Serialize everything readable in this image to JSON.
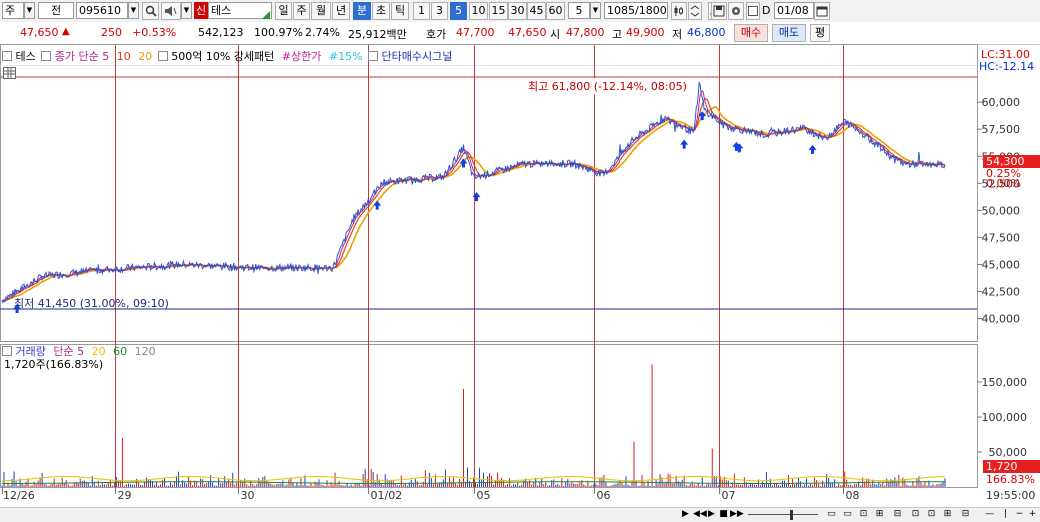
{
  "toolbar": {
    "market": "주",
    "period_type": "전",
    "code": "095610",
    "badge": "신",
    "name": "테스",
    "periods": [
      "일",
      "주",
      "월",
      "년",
      "분",
      "초",
      "틱"
    ],
    "selected_period": "분",
    "minutes": [
      "1",
      "3",
      "5",
      "10",
      "15",
      "30",
      "45",
      "60"
    ],
    "selected_minute": "5",
    "count_input": "5",
    "bars": "1085",
    "bars_total": "/1800",
    "d_label": "D",
    "date": "01/08"
  },
  "quote": {
    "price": "47,650",
    "arrow": "▲",
    "change": "250",
    "change_pct": "+0.53%",
    "volume": "542,123",
    "vol_ratio": "100.97%",
    "turnover": "2.74%",
    "amount": "25,912백만",
    "ask_label": "호가",
    "ask": "47,700",
    "bid": "47,650",
    "open_label": "시",
    "open": "47,800",
    "high_label": "고",
    "high": "49,900",
    "low_label": "저",
    "low": "46,800",
    "buy": "매수",
    "sell": "매도",
    "eval": "평"
  },
  "legend": {
    "name": "테스",
    "ma_label": "종가 단순",
    "ma5": "5",
    "ma10": "10",
    "ma20": "20",
    "amount_filter": "500억 10%",
    "pattern": "강세패턴",
    "limit_up": "#상한가",
    "pct15": "#15%",
    "signal": "단타매수시그널",
    "lc": "LC:31.00",
    "hc": "HC:-12.14"
  },
  "volume_legend": {
    "name": "거래량",
    "ma_label": "단순",
    "ma5": "5",
    "ma20": "20",
    "ma60": "60",
    "ma120": "120",
    "info": "1,720주(166.83%)"
  },
  "annotations": {
    "high": "최고 61,800 (-12.14%, 08:05)",
    "low": "최저 41,450 (31.00%, 09:10)"
  },
  "price_axis": {
    "ticks": [
      "60,000",
      "57,500",
      "55,000",
      "52,500",
      "50,000",
      "47,500",
      "45,000",
      "42,500",
      "40,000"
    ],
    "current": "54,300",
    "pct1": "0.25%",
    "pct2": "0.00%"
  },
  "volume_axis": {
    "ticks": [
      "150,000",
      "100,000",
      "50,000"
    ],
    "current": "1,720",
    "pct": "166.83%"
  },
  "time_axis": {
    "labels": [
      "12/26",
      "29",
      "30",
      "01/02",
      "05",
      "06",
      "07",
      "08"
    ],
    "clock": "19:55:00"
  },
  "colors": {
    "price_line": "#2b55c8",
    "ma5": "#c02890",
    "ma10": "#d43a1a",
    "ma20": "#f0a000",
    "day_line": "#c23a3a",
    "high_line": "#c23a3a",
    "low_line": "#1f2a78",
    "signal": "#1040e0"
  },
  "chart_data": [
    {
      "type": "line",
      "title": "",
      "ylim": [
        39500,
        62600
      ],
      "days": [
        "12/26",
        "29",
        "30",
        "01/02",
        "05",
        "06",
        "07",
        "08"
      ],
      "series": [
        {
          "name": "테스",
          "x_bar_index": [
            0,
            40,
            100,
            180,
            250,
            330,
            350,
            380,
            440,
            460,
            470,
            520,
            570,
            600,
            630,
            660,
            690,
            695,
            700,
            720,
            760,
            800,
            820,
            840,
            860,
            890,
            900,
            940
          ],
          "values": [
            41700,
            43900,
            44500,
            45000,
            44700,
            44700,
            49200,
            52600,
            53100,
            55800,
            53000,
            54300,
            54300,
            53300,
            56600,
            58500,
            57200,
            61800,
            59300,
            57800,
            57000,
            57600,
            56600,
            58200,
            57000,
            54700,
            54300,
            54200
          ]
        }
      ],
      "high": {
        "value": 61800,
        "label": "최고 61,800 (-12.14%, 08:05)"
      },
      "low": {
        "value": 41450,
        "label": "최저 41,450 (31.00%, 09:10)"
      },
      "current": 54300
    },
    {
      "type": "bar",
      "title": "",
      "series_name": "거래량",
      "ylim": [
        0,
        190000
      ],
      "spikes": [
        {
          "day": "12/26",
          "value": 20000
        },
        {
          "day": "29",
          "value": 70000
        },
        {
          "day": "01/02",
          "value": 40000
        },
        {
          "day": "05",
          "value": 100000
        },
        {
          "day": "06",
          "value": 65000
        },
        {
          "day": "06",
          "value": 175000
        },
        {
          "day": "07",
          "value": 55000
        }
      ],
      "current": 1720
    }
  ]
}
